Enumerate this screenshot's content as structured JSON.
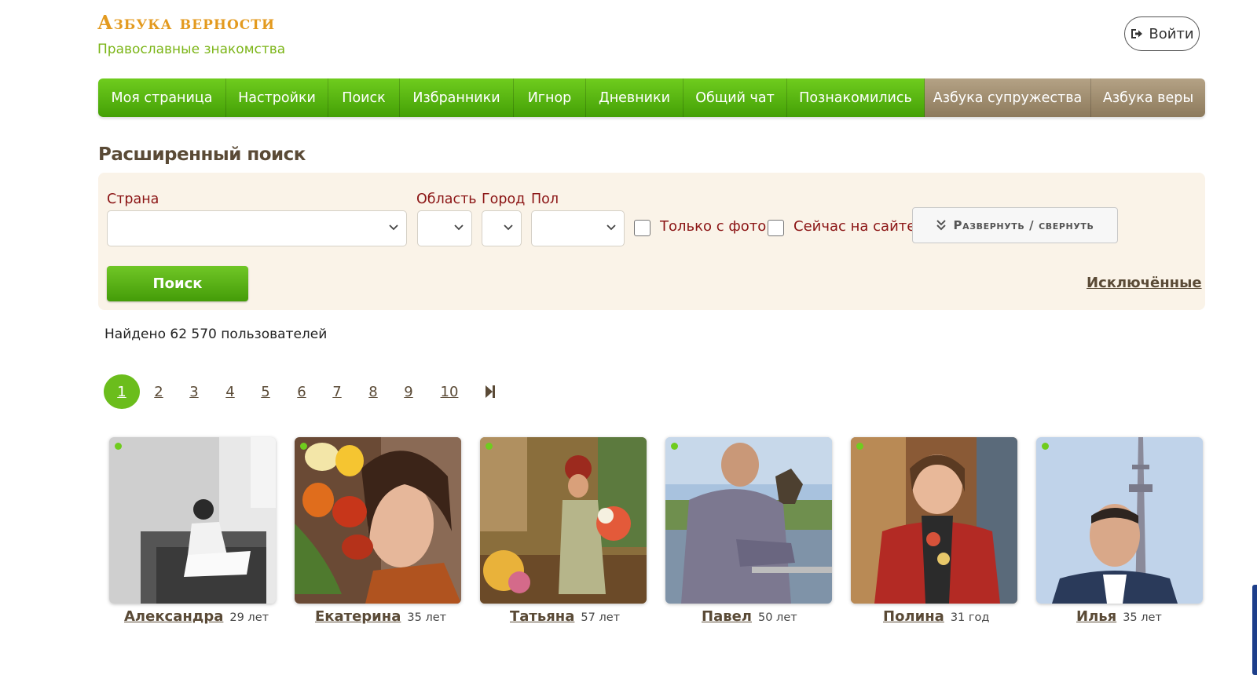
{
  "brand": {
    "title": "Азбука верности",
    "subtitle": "Православные знакомства"
  },
  "header": {
    "login_label": "Войти",
    "login_icon": "sign-in-icon"
  },
  "nav": {
    "items": [
      {
        "label": "Моя страница",
        "theme": "green"
      },
      {
        "label": "Настройки",
        "theme": "green"
      },
      {
        "label": "Поиск",
        "theme": "green"
      },
      {
        "label": "Избранники",
        "theme": "green"
      },
      {
        "label": "Игнор",
        "theme": "green"
      },
      {
        "label": "Дневники",
        "theme": "green"
      },
      {
        "label": "Общий чат",
        "theme": "green"
      },
      {
        "label": "Познакомились",
        "theme": "green"
      },
      {
        "label": "Азбука супружества",
        "theme": "brown"
      },
      {
        "label": "Азбука веры",
        "theme": "brown"
      }
    ]
  },
  "search": {
    "title": "Расширенный поиск",
    "country_label": "Страна",
    "country_value": "",
    "region_label": "Область",
    "region_value": "",
    "city_label": "Город",
    "city_value": "",
    "gender_label": "Пол",
    "gender_value": "",
    "photo_only_label": "Только с фото",
    "photo_only_checked": false,
    "online_label": "Сейчас на сайте",
    "online_checked": false,
    "expand_label": "Развернуть / свернуть",
    "expand_icon": "double-chevron-down-icon",
    "search_button": "Поиск",
    "excluded_link": "Исключённые"
  },
  "results": {
    "found_text": "Найдено 62 570 пользователей"
  },
  "pagination": {
    "pages": [
      "1",
      "2",
      "3",
      "4",
      "5",
      "6",
      "7",
      "8",
      "9",
      "10"
    ],
    "active": "1",
    "last_icon": "skip-to-last-icon"
  },
  "profiles": [
    {
      "name": "Александра",
      "age": "29 лет",
      "online": true
    },
    {
      "name": "Екатерина",
      "age": "35 лет",
      "online": true
    },
    {
      "name": "Татьяна",
      "age": "57 лет",
      "online": true
    },
    {
      "name": "Павел",
      "age": "50 лет",
      "online": true
    },
    {
      "name": "Полина",
      "age": "31 год",
      "online": true
    },
    {
      "name": "Илья",
      "age": "35 лет",
      "online": true
    }
  ],
  "colors": {
    "brand_orange": "#e39a1f",
    "brand_green": "#7cb518",
    "nav_green": "#5bb512",
    "nav_brown": "#a08e70",
    "label_red": "#8b1414",
    "heading_brown": "#5a4a36",
    "panel_bg": "#faf3e8",
    "online_dot": "#6fcc1e"
  }
}
